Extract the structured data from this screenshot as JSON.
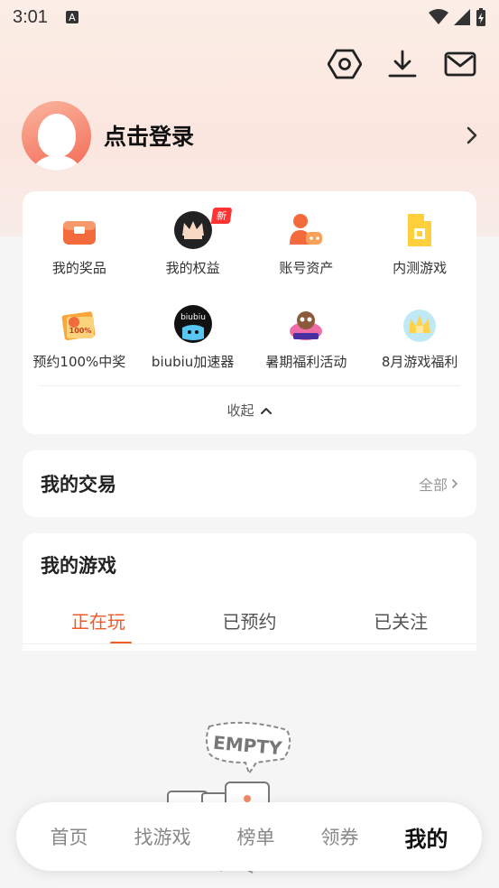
{
  "status_bar": {
    "time": "3:01",
    "notification_icon": "text-a-icon"
  },
  "top_actions": [
    "settings-hex-icon",
    "download-icon",
    "mail-icon"
  ],
  "profile": {
    "login_text": "点击登录"
  },
  "quick_grid": [
    {
      "label": "我的奖品",
      "icon": "prize-box-icon"
    },
    {
      "label": "我的权益",
      "icon": "crown-avatar-icon",
      "badge": "新"
    },
    {
      "label": "账号资产",
      "icon": "account-asset-icon"
    },
    {
      "label": "内测游戏",
      "icon": "beta-game-icon"
    },
    {
      "label": "预约100%中奖",
      "icon": "reservation-reward-icon",
      "icon_text": "100%"
    },
    {
      "label": "biubiu加速器",
      "icon": "biubiu-accelerator-icon",
      "icon_text": "biubiu"
    },
    {
      "label": "暑期福利活动",
      "icon": "summer-event-icon"
    },
    {
      "label": "8月游戏福利",
      "icon": "august-welfare-icon"
    }
  ],
  "collapse_label": "收起",
  "trade": {
    "title": "我的交易",
    "all_label": "全部"
  },
  "games": {
    "title": "我的游戏",
    "tabs": [
      "正在玩",
      "已预约",
      "已关注"
    ],
    "active_tab": 0,
    "empty_label": "EMPTY"
  },
  "bottom_nav": {
    "items": [
      "首页",
      "找游戏",
      "榜单",
      "领券",
      "我的"
    ],
    "active": 4
  },
  "colors": {
    "accent": "#ef5a2a",
    "badge": "#ff3333",
    "header_bg": "#fbeee6"
  }
}
